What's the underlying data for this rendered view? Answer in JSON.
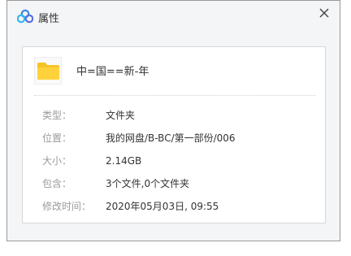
{
  "window": {
    "title": "属性",
    "app_icon": "baidu-netdisk-cloud-icon",
    "close_icon": "close-x-icon"
  },
  "file": {
    "icon": "folder-icon",
    "icon_color": "#f7c325",
    "name": "中=国==新-年"
  },
  "properties": [
    {
      "label": "类型：",
      "value": "文件夹"
    },
    {
      "label": "位置：",
      "value": "我的网盘/B-BC/第一部份/006"
    },
    {
      "label": "大小：",
      "value": "2.14GB"
    },
    {
      "label": "包含：",
      "value": "3个文件,0个文件夹"
    },
    {
      "label": "修改时间：",
      "value": "2020年05月03日, 09:55"
    }
  ]
}
